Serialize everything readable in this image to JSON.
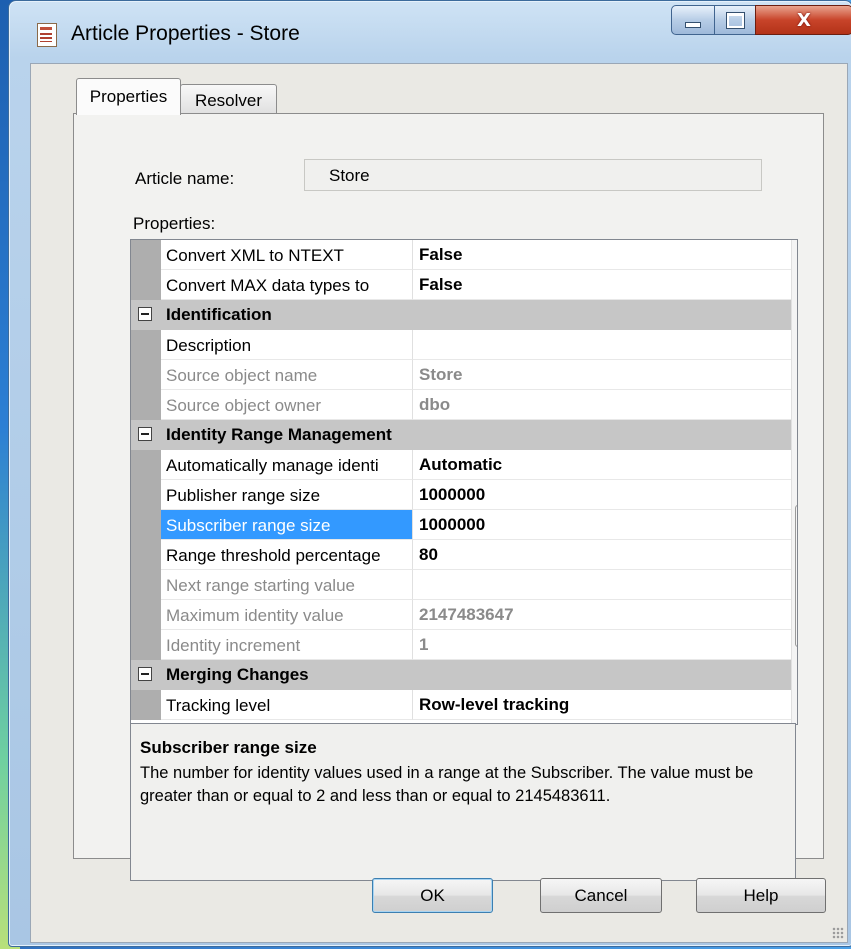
{
  "window": {
    "title": "Article Properties - Store"
  },
  "tabs": [
    {
      "label": "Properties"
    },
    {
      "label": "Resolver"
    }
  ],
  "article_name": {
    "label": "Article name:",
    "value": "Store"
  },
  "properties_label": "Properties:",
  "grid": {
    "rows": [
      {
        "kind": "prop",
        "name": "Convert XML to NTEXT",
        "value": "False",
        "state": "normal"
      },
      {
        "kind": "prop",
        "name": "Convert MAX data types to",
        "value": "False",
        "state": "normal"
      },
      {
        "kind": "category",
        "name": "Identification"
      },
      {
        "kind": "prop",
        "name": "Description",
        "value": "",
        "state": "normal"
      },
      {
        "kind": "prop",
        "name": "Source object name",
        "value": "Store",
        "state": "disabled"
      },
      {
        "kind": "prop",
        "name": "Source object owner",
        "value": "dbo",
        "state": "disabled"
      },
      {
        "kind": "category",
        "name": "Identity Range Management"
      },
      {
        "kind": "prop",
        "name": "Automatically manage identi",
        "value": "Automatic",
        "state": "normal"
      },
      {
        "kind": "prop",
        "name": "Publisher range size",
        "value": "1000000",
        "state": "normal"
      },
      {
        "kind": "prop",
        "name": "Subscriber range size",
        "value": "1000000",
        "state": "selected"
      },
      {
        "kind": "prop",
        "name": "Range threshold percentage",
        "value": "80",
        "state": "normal"
      },
      {
        "kind": "prop",
        "name": "Next range starting value",
        "value": "",
        "state": "disabled"
      },
      {
        "kind": "prop",
        "name": "Maximum identity value",
        "value": "2147483647",
        "state": "disabled"
      },
      {
        "kind": "prop",
        "name": "Identity increment",
        "value": "1",
        "state": "disabled"
      },
      {
        "kind": "category",
        "name": "Merging Changes"
      },
      {
        "kind": "prop",
        "name": "Tracking level",
        "value": "Row-level tracking",
        "state": "normal"
      }
    ]
  },
  "description": {
    "title": "Subscriber range size",
    "text": "The number for identity values used in a range at the Subscriber. The value must be greater than or equal to 2 and less than or equal to 2145483611."
  },
  "buttons": {
    "ok": "OK",
    "cancel": "Cancel",
    "help": "Help"
  },
  "title_buttons": {
    "close": "X"
  },
  "colors": {
    "selection": "#3399ff",
    "category_bg": "#c6c6c6",
    "disabled_text": "#8a8a8a"
  }
}
